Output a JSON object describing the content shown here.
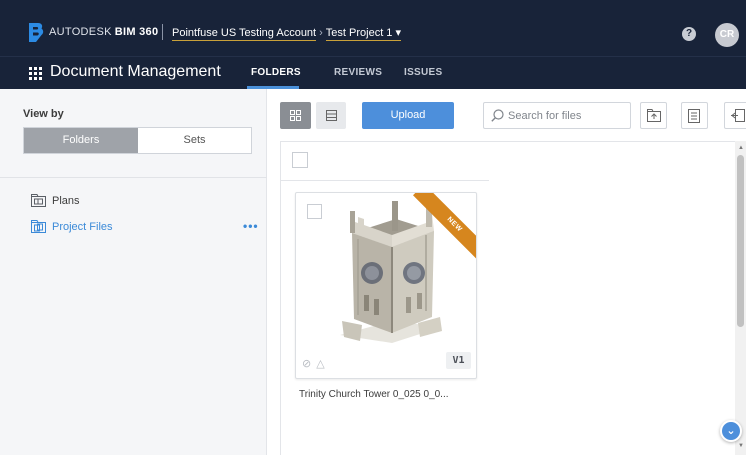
{
  "header": {
    "brand_prefix": "AUTODESK",
    "brand_product": "BIM 360",
    "account": "Pointfuse US Testing Account",
    "breadcrumb_sep": "›",
    "project": "Test Project 1",
    "project_caret": "▾",
    "help_label": "?",
    "avatar_initials": "CR"
  },
  "module": {
    "title": "Document Management",
    "tabs": [
      {
        "label": "FOLDERS",
        "active": true
      },
      {
        "label": "REVIEWS",
        "active": false
      },
      {
        "label": "ISSUES",
        "active": false
      }
    ]
  },
  "sidebar": {
    "view_by_label": "View by",
    "segments": [
      {
        "label": "Folders",
        "selected": true
      },
      {
        "label": "Sets",
        "selected": false
      }
    ],
    "tree": [
      {
        "label": "Plans",
        "icon": "plans-folder-icon",
        "active": false
      },
      {
        "label": "Project Files",
        "icon": "project-files-folder-icon",
        "active": true
      }
    ],
    "more_label": "•••"
  },
  "toolbar": {
    "upload_label": "Upload",
    "search_placeholder": "Search for files"
  },
  "files": [
    {
      "name": "Trinity Church Tower 0_025 0_0...",
      "badge": "NEW",
      "version": "V1"
    }
  ],
  "colors": {
    "header_bg": "#182339",
    "accent": "#4d8fdb",
    "ribbon": "#d6861e",
    "active_link": "#3b8ad8"
  }
}
